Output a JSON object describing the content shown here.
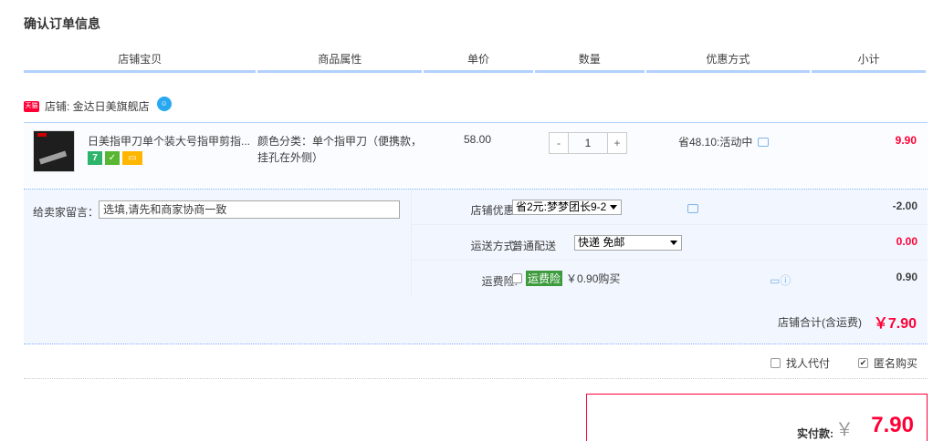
{
  "page": {
    "title": "确认订单信息"
  },
  "columns": [
    "店铺宝贝",
    "商品属性",
    "单价",
    "数量",
    "优惠方式",
    "小计"
  ],
  "shop": {
    "badge": "天猫",
    "label": "店铺: 金达日美旗舰店"
  },
  "item": {
    "name": "日美指甲刀单个装大号指甲剪指...",
    "attr": "颜色分类：单个指甲刀（便携款，挂孔在外侧）",
    "price": "58.00",
    "qty_minus": "-",
    "qty_value": "1",
    "qty_plus": "+",
    "discount": "省48.10:活动中",
    "subtotal": "9.90",
    "badge_seven": "7"
  },
  "memo": {
    "label": "给卖家留言：",
    "placeholder": "选填,请先和商家协商一致"
  },
  "shop_discount": {
    "label": "店铺优惠:",
    "selected": "省2元:梦梦团长9-2",
    "amount": "-2.00"
  },
  "shipping": {
    "label": "运送方式:",
    "type": "普通配送",
    "selected": "快递 免邮",
    "amount": "0.00"
  },
  "insurance": {
    "label": "运费险:",
    "tag": "运费险",
    "desc": "￥0.90购买",
    "amount": "0.90"
  },
  "shop_total": {
    "label": "店铺合计(含运费)",
    "value": "￥7.90"
  },
  "options": {
    "proxy_pay": "找人代付",
    "anonymous": "匿名购买"
  },
  "payment": {
    "label": "实付款:",
    "yen": "￥",
    "value": "7.90"
  },
  "colors": {
    "accent": "#ff0036",
    "header_border": "#b2d1ff",
    "panel_bg": "#f2f7ff"
  }
}
